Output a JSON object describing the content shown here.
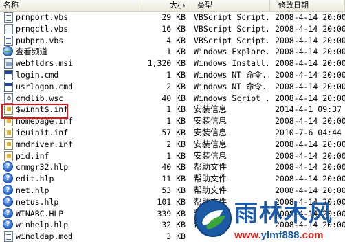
{
  "columns": {
    "name": "名称",
    "size": "大小",
    "type": "类型",
    "modified": "修改日期"
  },
  "files": [
    {
      "name": "prnport.vbs",
      "size": "29 KB",
      "type": "VBScript Script...",
      "modified": "2008-4-14 20:00",
      "icon": "script-icon"
    },
    {
      "name": "prnqctl.vbs",
      "size": "16 KB",
      "type": "VBScript Script...",
      "modified": "2008-4-14 20:00",
      "icon": "script-icon"
    },
    {
      "name": "pubprn.vbs",
      "size": "4 KB",
      "type": "VBScript Script...",
      "modified": "2008-4-14 20:00",
      "icon": "script-icon"
    },
    {
      "name": "查看频道",
      "size": "1 KB",
      "type": "Windows Explore...",
      "modified": "2008-4-14 20:00",
      "icon": "globe-icon"
    },
    {
      "name": "webfldrs.msi",
      "size": "1,320 KB",
      "type": "Windows Install...",
      "modified": "2008-4-14 20:00",
      "icon": "installer-icon"
    },
    {
      "name": "login.cmd",
      "size": "1 KB",
      "type": "Windows NT 命令...",
      "modified": "2008-4-14 20:00",
      "icon": "command-icon"
    },
    {
      "name": "usrlogon.cmd",
      "size": "2 KB",
      "type": "Windows NT 命令...",
      "modified": "2008-4-14 20:00",
      "icon": "command-icon"
    },
    {
      "name": "cmdlib.wsc",
      "size": "40 KB",
      "type": "Windows Script ...",
      "modified": "2008-4-14 20:00",
      "icon": "component-icon"
    },
    {
      "name": "$winnt$.inf",
      "size": "1 KB",
      "type": "安装信息",
      "modified": "2014-4-1 09:37",
      "icon": "setup-info-icon"
    },
    {
      "name": "homepage.inf",
      "size": "1 KB",
      "type": "安装信息",
      "modified": "2008-4-14 20:00",
      "icon": "setup-info-icon"
    },
    {
      "name": "ieuinit.inf",
      "size": "57 KB",
      "type": "安装信息",
      "modified": "2010-7-6 04:44",
      "icon": "setup-info-icon"
    },
    {
      "name": "mmdriver.inf",
      "size": "2 KB",
      "type": "安装信息",
      "modified": "2008-4-14 20:00",
      "icon": "setup-info-icon"
    },
    {
      "name": "pid.inf",
      "size": "1 KB",
      "type": "安装信息",
      "modified": "2008-4-14 20:00",
      "icon": "setup-info-icon"
    },
    {
      "name": "cmmgr32.hlp",
      "size": "40 KB",
      "type": "帮助文件",
      "modified": "2008-4-14 20:00",
      "icon": "help-icon"
    },
    {
      "name": "edit.hlp",
      "size": "11 KB",
      "type": "帮助文件",
      "modified": "2008-4-14 20:00",
      "icon": "help-icon"
    },
    {
      "name": "net.hlp",
      "size": "53 KB",
      "type": "帮助文件",
      "modified": "2008-4-14 20:00",
      "icon": "help-icon"
    },
    {
      "name": "netus.hlp",
      "size": "101 KB",
      "type": "帮助文件",
      "modified": "2008-4-14 20:00",
      "icon": "help-icon"
    },
    {
      "name": "WINABC.HLP",
      "size": "339 KB",
      "type": "帮助文件",
      "modified": "2008-4-14 20:00",
      "icon": "help-icon"
    },
    {
      "name": "winhelp.hlp",
      "size": "32 KB",
      "type": "帮助文件",
      "modified": "2008-4-14 20:00",
      "icon": "help-icon"
    },
    {
      "name": "winoldap.mod",
      "size": "3 KB",
      "type": "",
      "modified": "",
      "icon": "file-icon"
    }
  ],
  "watermark": {
    "title": "雨林木风",
    "url_prefix": "www.",
    "url_domain": "ylmf888",
    "url_suffix": ".com",
    "colors": {
      "blue": "#1c5aa5",
      "red": "#d6261e",
      "green": "#3aa63a"
    }
  },
  "highlight_color": "#e0141b"
}
